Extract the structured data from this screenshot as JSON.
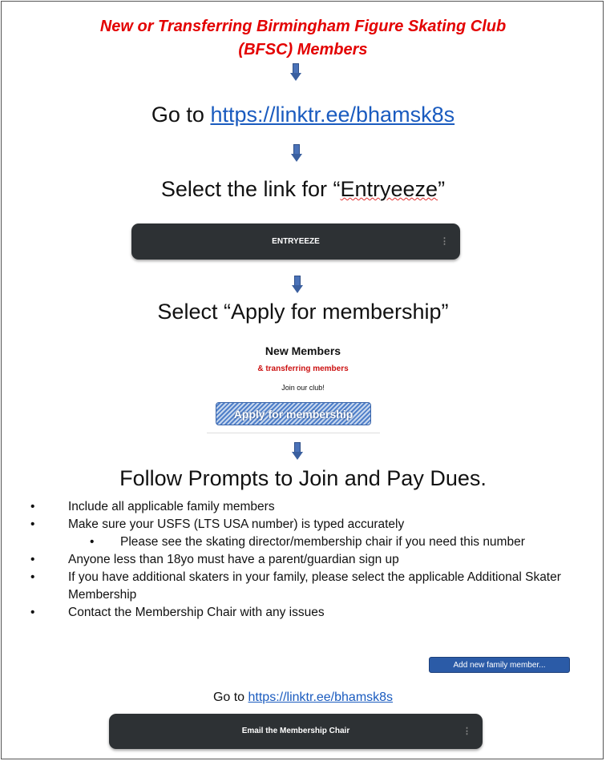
{
  "header": {
    "title_line1": "New or Transferring Birmingham Figure Skating Club",
    "title_line2": "(BFSC) Members"
  },
  "step1": {
    "prefix": "Go to ",
    "link": "https://linktr.ee/bhamsk8s"
  },
  "step2": {
    "prefix": "Select the link for “",
    "word": "Entryeeze",
    "suffix": "”"
  },
  "entryeeze_button": {
    "label": "ENTRYEEZE",
    "menu": "⋮"
  },
  "step3": {
    "text": "Select “Apply for membership”"
  },
  "new_members_panel": {
    "title": "New Members",
    "subtitle": "& transferring members",
    "join": "Join our club!",
    "apply_label": "Apply for membership"
  },
  "step4": {
    "text": "Follow Prompts to Join and Pay Dues."
  },
  "bullets": {
    "b1": "Include all applicable family members",
    "b2": "Make sure your USFS (LTS USA number) is typed accurately",
    "b2a": "Please see the skating director/membership chair if you need this number",
    "b3": "Anyone less than 18yo must have a parent/guardian sign up",
    "b4": "If you have additional skaters in your family, please select the applicable Additional Skater Membership",
    "b5": "Contact the Membership Chair with any issues"
  },
  "add_family_button": {
    "label": "Add new family member..."
  },
  "footer": {
    "prefix": "Go to ",
    "link": "https://linktr.ee/bhamsk8s",
    "email_button_label": "Email the Membership Chair",
    "menu": "⋮"
  },
  "colors": {
    "title_red": "#e30000",
    "link_blue": "#1a5bbf",
    "arrow_blue": "#4a72b8",
    "dark_button": "#2d3134"
  }
}
